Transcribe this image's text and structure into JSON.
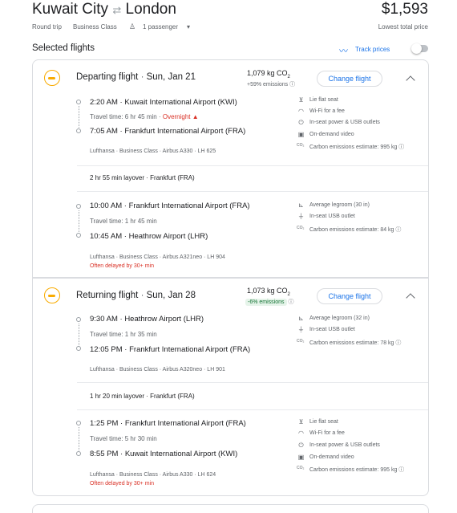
{
  "header": {
    "origin": "Kuwait City",
    "destination": "London",
    "swap_icon": "swap-arrows-icon",
    "trip_type": "Round trip",
    "cabin": "Business Class",
    "passengers": "1 passenger",
    "price": "$1,593",
    "price_note": "Lowest total price"
  },
  "selected": {
    "title": "Selected flights",
    "track_label": "Track prices",
    "track_on": false
  },
  "departing": {
    "heading": "Departing flight",
    "date": "Sun, Jan 21",
    "co2": "1,079 kg CO",
    "co2_sub": "2",
    "emissions": "+59% emissions",
    "change_label": "Change flight",
    "seg1": {
      "dep_time": "2:20 AM",
      "dep_airport": "Kuwait International Airport (KWI)",
      "travel_time": "Travel time: 6 hr 45 min",
      "overnight": "Overnight",
      "arr_time": "7:05 AM",
      "arr_airport": "Frankfurt International Airport (FRA)",
      "details": "Lufthansa · Business Class · Airbus A330 · LH 625",
      "amenities": [
        "Lie flat seat",
        "Wi-Fi for a fee",
        "In-seat power & USB outlets",
        "On-demand video",
        "Carbon emissions estimate: 995 kg"
      ]
    },
    "layover": "2 hr 55 min layover · Frankfurt (FRA)",
    "seg2": {
      "dep_time": "10:00 AM",
      "dep_airport": "Frankfurt International Airport (FRA)",
      "travel_time": "Travel time: 1 hr 45 min",
      "arr_time": "10:45 AM",
      "arr_airport": "Heathrow Airport (LHR)",
      "details": "Lufthansa · Business Class · Airbus A321neo · LH 904",
      "delay": "Often delayed by 30+ min",
      "amenities": [
        "Average legroom (30 in)",
        "In-seat USB outlet",
        "Carbon emissions estimate: 84 kg"
      ]
    }
  },
  "returning": {
    "heading": "Returning flight",
    "date": "Sun, Jan 28",
    "co2": "1,073 kg CO",
    "co2_sub": "2",
    "emissions": "-6% emissions",
    "change_label": "Change flight",
    "seg1": {
      "dep_time": "9:30 AM",
      "dep_airport": "Heathrow Airport (LHR)",
      "travel_time": "Travel time: 1 hr 35 min",
      "arr_time": "12:05 PM",
      "arr_airport": "Frankfurt International Airport (FRA)",
      "details": "Lufthansa · Business Class · Airbus A320neo · LH 901",
      "amenities": [
        "Average legroom (32 in)",
        "In-seat USB outlet",
        "Carbon emissions estimate: 78 kg"
      ]
    },
    "layover": "1 hr 20 min layover · Frankfurt (FRA)",
    "seg2": {
      "dep_time": "1:25 PM",
      "dep_airport": "Frankfurt International Airport (FRA)",
      "travel_time": "Travel time: 5 hr 30 min",
      "arr_time": "8:55 PM",
      "arr_airport": "Kuwait International Airport (KWI)",
      "details": "Lufthansa · Business Class · Airbus A330 · LH 624",
      "delay": "Often delayed by 30+ min",
      "amenities": [
        "Lie flat seat",
        "Wi-Fi for a fee",
        "In-seat power & USB outlets",
        "On-demand video",
        "Carbon emissions estimate: 995 kg"
      ]
    }
  },
  "colors": {
    "accent": "#1a73e8",
    "warning": "#d93025",
    "good": "#137333",
    "good_bg": "#e6f4ea",
    "airline": "#f9ab00"
  }
}
